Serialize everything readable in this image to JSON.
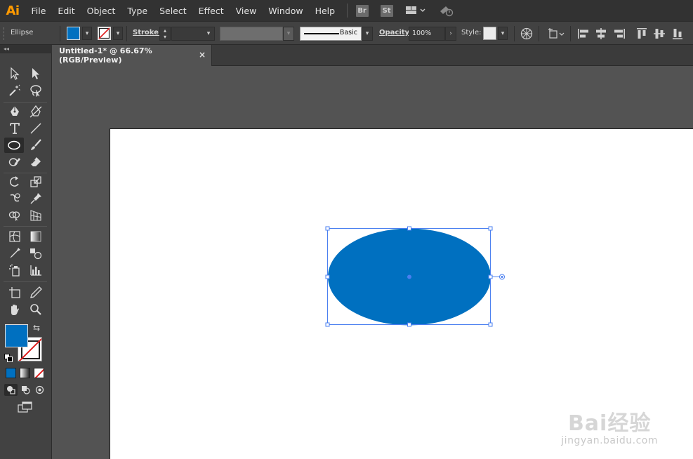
{
  "app": {
    "logo": "Ai"
  },
  "menu": [
    "File",
    "Edit",
    "Object",
    "Type",
    "Select",
    "Effect",
    "View",
    "Window",
    "Help"
  ],
  "menubar_icons": {
    "bridge": "Br",
    "stock": "St"
  },
  "control": {
    "object_type": "Ellipse",
    "stroke_label": "Stroke:",
    "brush_label": "Basic",
    "opacity_label": "Opacity:",
    "opacity_value": "100%",
    "style_label": "Style:"
  },
  "colors": {
    "fill": "#0070c0",
    "selection": "#4a7ff0",
    "accent": "#ff9a00"
  },
  "document": {
    "tab_title": "Untitled-1* @ 66.67% (RGB/Preview)",
    "close": "×"
  },
  "watermark": {
    "main": "Bai经验",
    "sub": "jingyan.baidu.com"
  }
}
